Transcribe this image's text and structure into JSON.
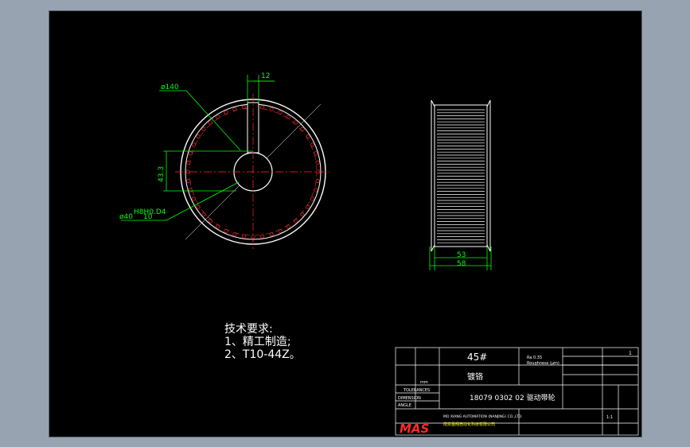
{
  "dimensions": {
    "key_width": "12",
    "outer_dia": "ø140",
    "key_depth": "43.3",
    "bore_fit": "H8H0.D4",
    "bore_dia": "ø40",
    "bore_len": "10",
    "width_inner": "53",
    "width_outer": "58"
  },
  "notes": {
    "title": "技术要求:",
    "line1": "1、精工制造;",
    "line2": "2、T10-44Z。"
  },
  "title_block": {
    "material": "45#",
    "treatment": "镀铬",
    "drawing_title": "18079 0302 02 驱动带轮",
    "surface_roughness": "Ra 0.35",
    "roughness_label": "Roughness (μm)",
    "brand": "MAS",
    "company_en": "MO XIANG AUTOMATION (NANJING) CO.,LTD.",
    "company_cn": "南京墨翔自动化科技有限公司",
    "tolerances": "TOLERANCES",
    "dimension": "DIMENSION",
    "angle": "ANGLE",
    "unit": "mm",
    "scale": "1:1",
    "sheet": "1"
  },
  "colors": {
    "background": "#000000",
    "outline": "#ffffff",
    "dimension": "#00ff00",
    "centerline": "#ff2a2a",
    "frame_bg": "#97a3b1"
  }
}
